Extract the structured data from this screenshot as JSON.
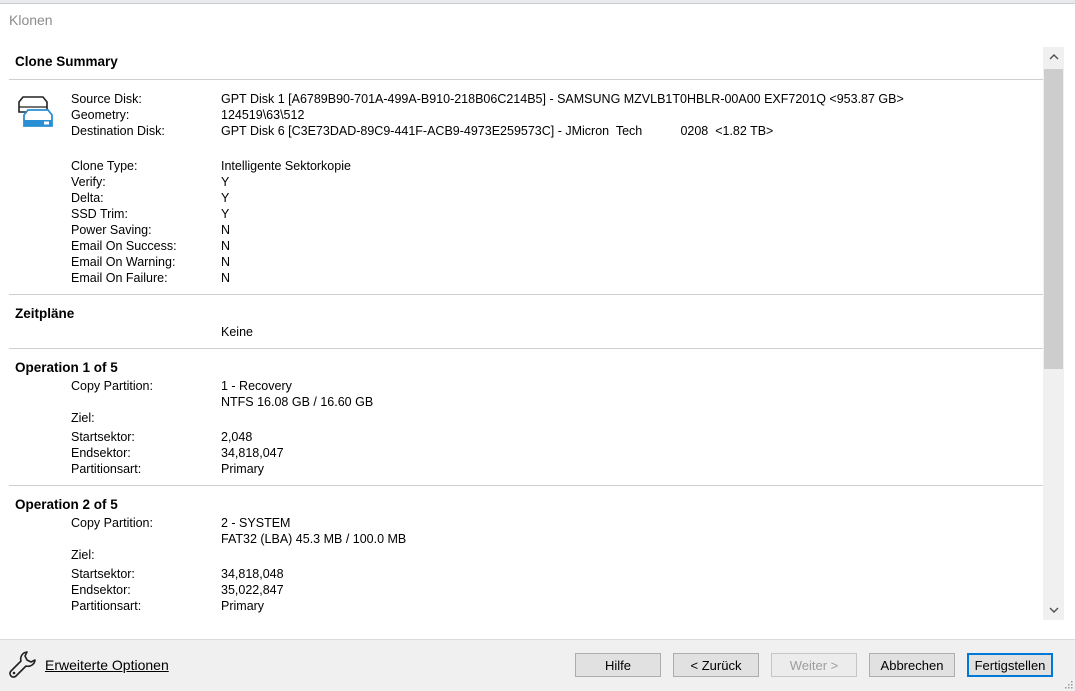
{
  "window": {
    "title": "Klonen"
  },
  "summary": {
    "title": "Clone Summary",
    "source_disk": {
      "label": "Source Disk:",
      "value": "GPT Disk 1 [A6789B90-701A-499A-B910-218B06C214B5] - SAMSUNG MZVLB1T0HBLR-00A00 EXF7201Q  <953.87 GB>"
    },
    "geometry": {
      "label": "Geometry:",
      "value": "124519\\63\\512"
    },
    "destination_disk": {
      "label": "Destination Disk:",
      "value": "GPT Disk 6 [C3E73DAD-89C9-441F-ACB9-4973E259573C] - JMicron  Tech           0208  <1.82 TB>"
    },
    "clone_type": {
      "label": "Clone Type:",
      "value": "Intelligente Sektorkopie"
    },
    "verify": {
      "label": "Verify:",
      "value": "Y"
    },
    "delta": {
      "label": "Delta:",
      "value": "Y"
    },
    "ssd_trim": {
      "label": "SSD Trim:",
      "value": "Y"
    },
    "power_saving": {
      "label": "Power Saving:",
      "value": "N"
    },
    "email_success": {
      "label": "Email On Success:",
      "value": "N"
    },
    "email_warning": {
      "label": "Email On Warning:",
      "value": "N"
    },
    "email_failure": {
      "label": "Email On Failure:",
      "value": "N"
    }
  },
  "schedules": {
    "title": "Zeitpläne",
    "value": "Keine"
  },
  "operations": [
    {
      "title": "Operation 1 of 5",
      "copy_label": "Copy Partition:",
      "partition": "1 - Recovery",
      "fs_info": "NTFS 16.08 GB / 16.60 GB",
      "target_label": "Ziel:",
      "start_label": "Startsektor:",
      "start": "2,048",
      "end_label": "Endsektor:",
      "end": "34,818,047",
      "type_label": "Partitionsart:",
      "type": "Primary"
    },
    {
      "title": "Operation 2 of 5",
      "copy_label": "Copy Partition:",
      "partition": "2 - SYSTEM",
      "fs_info": "FAT32 (LBA) 45.3 MB / 100.0 MB",
      "target_label": "Ziel:",
      "start_label": "Startsektor:",
      "start": "34,818,048",
      "end_label": "Endsektor:",
      "end": "35,022,847",
      "type_label": "Partitionsart:",
      "type": "Primary"
    }
  ],
  "footer": {
    "advanced_options": "Erweiterte Optionen",
    "help": "Hilfe",
    "back": "< Zurück",
    "next": "Weiter >",
    "cancel": "Abbrechen",
    "finish": "Fertigstellen"
  },
  "icons": {
    "disk": "disk-clone-icon",
    "wrench": "wrench-icon",
    "scroll_up": "chevron-up-icon",
    "scroll_down": "chevron-down-icon"
  },
  "colors": {
    "accent": "#0078d7",
    "disk_icon": "#2a8fd4"
  }
}
